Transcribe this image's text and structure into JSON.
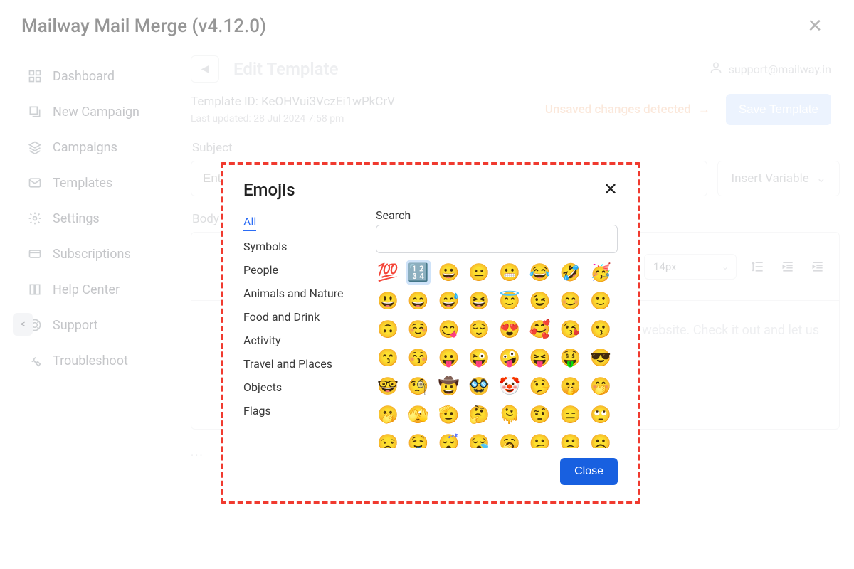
{
  "app_title": "Mailway Mail Merge (v4.12.0)",
  "sidebar": {
    "items": [
      {
        "label": "Dashboard",
        "icon": "grid-icon"
      },
      {
        "label": "New Campaign",
        "icon": "new-icon"
      },
      {
        "label": "Campaigns",
        "icon": "layers-icon"
      },
      {
        "label": "Templates",
        "icon": "mail-icon"
      },
      {
        "label": "Settings",
        "icon": "gear-icon"
      },
      {
        "label": "Subscriptions",
        "icon": "card-icon"
      },
      {
        "label": "Help Center",
        "icon": "book-icon"
      },
      {
        "label": "Support",
        "icon": "life-ring-icon"
      },
      {
        "label": "Troubleshoot",
        "icon": "wrench-icon"
      }
    ]
  },
  "edit": {
    "title": "Edit Template",
    "template_id_label": "Template ID:",
    "template_id": "KeOHVui3VczEi1wPkCrV",
    "last_updated": "Last updated: 28 Jul 2024 7:58 pm",
    "unsaved": "Unsaved changes detected",
    "save_label": "Save Template",
    "user_email": "support@mailway.in",
    "subject_label": "Subject",
    "subject_placeholder": "Enter subject",
    "insert_var_label": "Insert Variable",
    "body_label": "Body",
    "font_size": "14px",
    "body_text": "our website. Check it out and let us",
    "dots": "..."
  },
  "dialog": {
    "title": "Emojis",
    "search_label": "Search",
    "close_label": "Close",
    "categories": [
      "All",
      "Symbols",
      "People",
      "Animals and Nature",
      "Food and Drink",
      "Activity",
      "Travel and Places",
      "Objects",
      "Flags"
    ],
    "active_category": "All",
    "selected_emoji_index": 1,
    "emojis": [
      "💯",
      "🔢",
      "😀",
      "😐",
      "😬",
      "😂",
      "🤣",
      "🥳",
      "😃",
      "😄",
      "😅",
      "😆",
      "😇",
      "😉",
      "😊",
      "🙂",
      "🙃",
      "☺️",
      "😋",
      "😌",
      "😍",
      "🥰",
      "😘",
      "😗",
      "😙",
      "😚",
      "😛",
      "😜",
      "🤪",
      "😝",
      "🤑",
      "😎",
      "🤓",
      "🧐",
      "🤠",
      "🥸",
      "🤡",
      "🤥",
      "🤫",
      "🤭",
      "🫢",
      "🫣",
      "🫡",
      "🤔",
      "🫠",
      "🤨",
      "😑",
      "🙄",
      "😒",
      "🤤",
      "😴",
      "😪",
      "🥱",
      "😕",
      "🙁",
      "☹️"
    ]
  }
}
